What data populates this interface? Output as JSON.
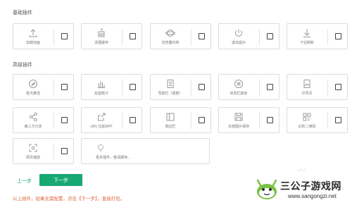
{
  "sections": {
    "basic_title": "基础插件",
    "advanced_title": "高级插件"
  },
  "basic_plugins": [
    {
      "label": "加载动画",
      "icon": "upload-arrow-icon"
    },
    {
      "label": "清理缓存",
      "icon": "clean-cache-icon"
    },
    {
      "label": "浏览器内核",
      "icon": "browser-kernel-icon"
    },
    {
      "label": "退出提示",
      "icon": "power-icon"
    },
    {
      "label": "下拉刷新",
      "icon": "pull-down-arrow-icon"
    }
  ],
  "advanced_plugins": [
    {
      "label": "极光推送",
      "icon": "aurora-push-icon"
    },
    {
      "label": "友盟统计",
      "icon": "bar-chart-icon"
    },
    {
      "label": "导航栏（底部）",
      "icon": "document-icon"
    },
    {
      "label": "状态栏颜色",
      "icon": "status-bar-icon"
    },
    {
      "label": "引导页",
      "icon": "guide-image-icon"
    },
    {
      "label": "第三方分享",
      "icon": "share-icon"
    },
    {
      "label": "URL 拉起APP",
      "icon": "export-icon"
    },
    {
      "label": "侧边栏",
      "icon": "sidebar-icon"
    },
    {
      "label": "长按图片保存",
      "icon": "save-icon"
    },
    {
      "label": "识别二维码",
      "icon": "qr-code-icon"
    },
    {
      "label": "网页缩放",
      "icon": "zoom-frame-icon"
    },
    {
      "label": "更多插件，敬请期待...",
      "icon": "lightbulb-icon"
    }
  ],
  "footer": {
    "prev_label": "上一步",
    "next_label": "下一步",
    "hint": "以上插件，如果无需配置，点击【下一步】，直接打包。"
  },
  "watermark": {
    "name": "三公子游戏网",
    "url": "www.sangongzi.net"
  },
  "colors": {
    "accent": "#18a874",
    "hint": "#e0663c",
    "card_border": "#dcdcdc"
  }
}
